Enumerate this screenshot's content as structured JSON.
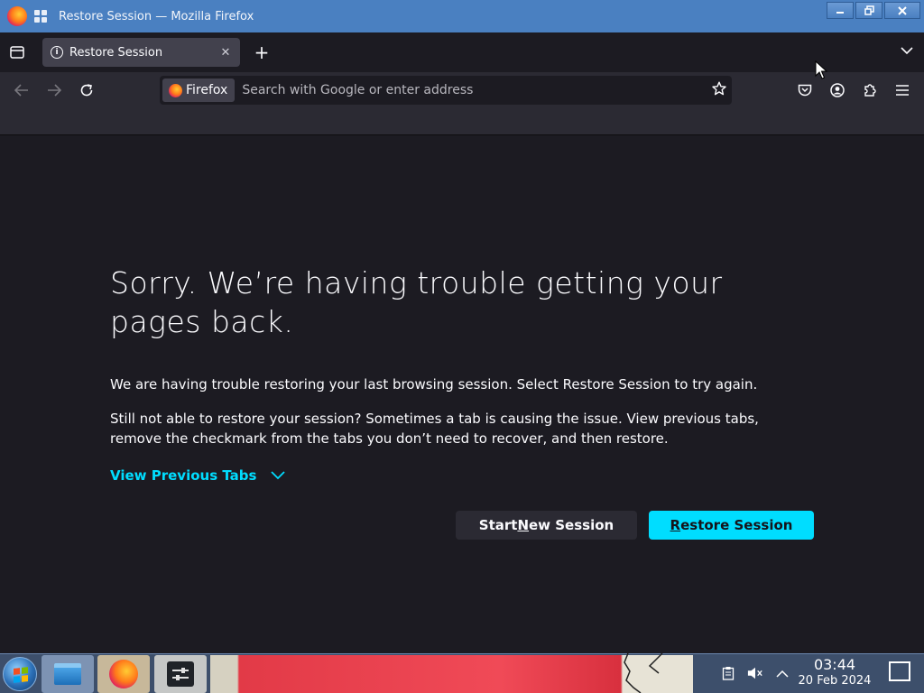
{
  "window": {
    "title": "Restore Session — Mozilla Firefox",
    "minimize_icon": "minimize-icon",
    "maximize_icon": "maximize-icon",
    "close_icon": "close-icon"
  },
  "tabs": {
    "active_tab_label": "Restore Session",
    "active_tab_icon": "info-icon",
    "close_symbol": "✕",
    "new_tab_symbol": "+",
    "overflow_symbol": "⌄"
  },
  "navbar": {
    "identity_label": "Firefox",
    "url_placeholder": "Search with Google or enter address",
    "url_value": ""
  },
  "content": {
    "heading": "Sorry. We’re having trouble getting your pages back.",
    "paragraph1": "We are having trouble restoring your last browsing session. Select Restore Session to try again.",
    "paragraph2": "Still not able to restore your session? Sometimes a tab is causing the issue. View previous tabs, remove the checkmark from the tabs you don’t need to recover, and then restore.",
    "view_previous_tabs": "View Previous Tabs",
    "start_new_prefix": "Start ",
    "start_new_accel": "N",
    "start_new_suffix": "ew Session",
    "restore_accel": "R",
    "restore_suffix": "estore Session",
    "accent_color": "#00ddff"
  },
  "taskbar": {
    "clock_time": "03:44",
    "clock_date": "20 Feb 2024"
  }
}
